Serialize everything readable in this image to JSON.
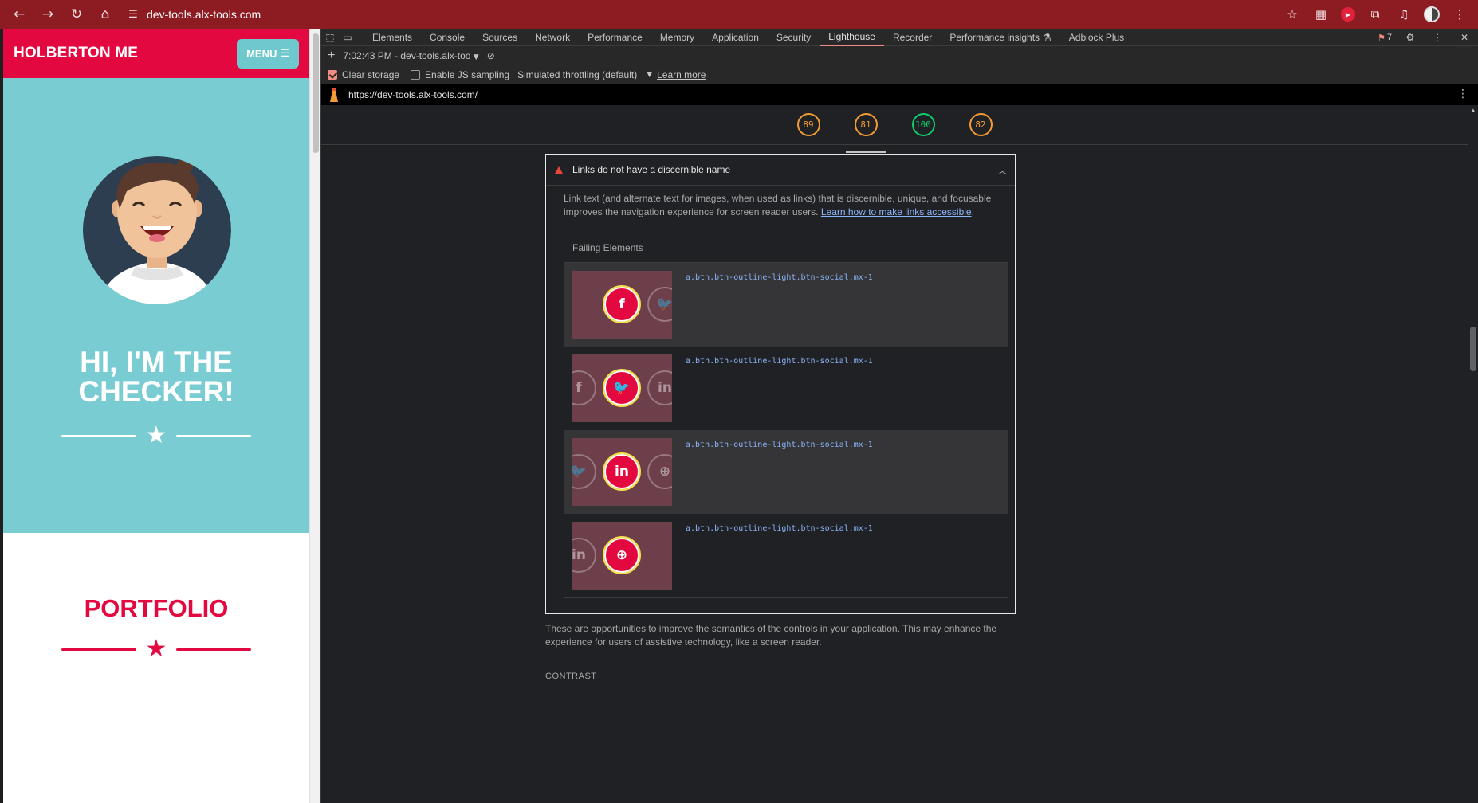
{
  "browser": {
    "url": "dev-tools.alx-tools.com",
    "issues_count": "7"
  },
  "page": {
    "brand": "HOLBERTON ME",
    "menu_label": "MENU",
    "hero_title_line1": "HI, I'M THE",
    "hero_title_line2": "CHECKER!",
    "portfolio_title": "PORTFOLIO",
    "colors": {
      "primary": "#e3083f",
      "hero_bg": "#79cdd2"
    }
  },
  "devtools": {
    "tabs": [
      "Elements",
      "Console",
      "Sources",
      "Network",
      "Performance",
      "Memory",
      "Application",
      "Security",
      "Lighthouse",
      "Recorder",
      "Performance insights",
      "Adblock Plus"
    ],
    "active_tab": "Lighthouse",
    "report_selector": "7:02:43 PM - dev-tools.alx-too",
    "clear_storage_label": "Clear storage",
    "clear_storage_checked": true,
    "js_sampling_label": "Enable JS sampling",
    "js_sampling_checked": false,
    "throttling_label": "Simulated throttling (default)",
    "learn_more": "Learn more",
    "report_url": "https://dev-tools.alx-tools.com/"
  },
  "scores": [
    {
      "value": "89",
      "status": "average"
    },
    {
      "value": "81",
      "status": "average",
      "active": true
    },
    {
      "value": "100",
      "status": "pass"
    },
    {
      "value": "82",
      "status": "average"
    }
  ],
  "audit": {
    "title": "Links do not have a discernible name",
    "description": "Link text (and alternate text for images, when used as links) that is discernible, unique, and focusable improves the navigation experience for screen reader users.",
    "link_text": "Learn how to make links accessible",
    "failing_header": "Failing Elements",
    "items": [
      {
        "selector": "a.btn.btn-outline-light.btn-social.mx-1",
        "icon": "facebook-icon",
        "glyph": "f"
      },
      {
        "selector": "a.btn.btn-outline-light.btn-social.mx-1",
        "icon": "twitter-icon",
        "glyph": "🐦"
      },
      {
        "selector": "a.btn.btn-outline-light.btn-social.mx-1",
        "icon": "linkedin-icon",
        "glyph": "in"
      },
      {
        "selector": "a.btn.btn-outline-light.btn-social.mx-1",
        "icon": "dribbble-icon",
        "glyph": "⊕"
      }
    ]
  },
  "footer": {
    "opportunity_text": "These are opportunities to improve the semantics of the controls in your application. This may enhance the experience for users of assistive technology, like a screen reader.",
    "section_title": "CONTRAST"
  }
}
